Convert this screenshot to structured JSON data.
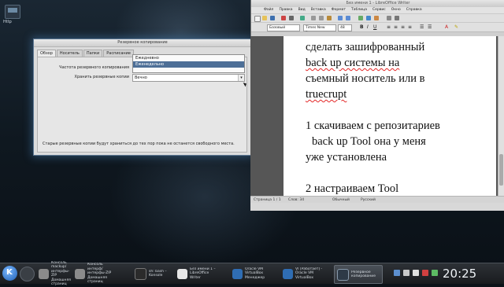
{
  "desktop": {
    "icon_label": "Http"
  },
  "backup_dialog": {
    "title": "Резервное копирование",
    "tabs": [
      "Обзор",
      "Носитель",
      "Папки",
      "Расписание"
    ],
    "frequency_label": "Частота резервного копирования",
    "frequency_options": [
      "Ежедневно",
      "Еженедельно"
    ],
    "keep_label": "Хранить резервные копии",
    "keep_value": "Вечно",
    "footer_note": "Старые резервные копии будут храниться до тех пор пока не останется свободного места."
  },
  "writer": {
    "title": "Без имени 1 - LibreOffice Writer",
    "menu": [
      "Файл",
      "Правка",
      "Вид",
      "Вставка",
      "Формат",
      "Таблица",
      "Сервис",
      "Окно",
      "Справка"
    ],
    "style": "Базовый",
    "font": "Times New Roman",
    "font_size": "48",
    "doc_lines": [
      "сделать зашифрованный",
      "back up системы на",
      "съемный носитель или в",
      "truecrupt",
      "1 скачиваем с репозитариев",
      "back up Tool она у меня",
      "уже установлена",
      "2 настраиваем Tool"
    ],
    "status": {
      "page": "Страница 1 / 1",
      "words": "Слов: 34",
      "style": "Обычный",
      "language": "Русский"
    }
  },
  "taskbar": {
    "tasks": [
      {
        "label": "Консоль mackup/интерфы-ZIP Домашняя страниц",
        "color": "#8b8b8b"
      },
      {
        "label": "Консоль интерф/интерфы-ZIP Домашняя страниц",
        "color": "#8b8b8b"
      },
      {
        "label": "sh: bash – Konsole",
        "color": "#2b2b2b"
      },
      {
        "label": "Без имени 1 – LibreOffice Writer",
        "color": "#e6e6e6"
      },
      {
        "label": "Oracle VM VirtualBox Менеджер",
        "color": "#2f6db3"
      },
      {
        "label": "VI [Работает] - Oracle VM VirtualBox",
        "color": "#2f6db3"
      },
      {
        "label": "Резервное копирование",
        "color": "#2e3a47"
      }
    ],
    "clock": "20:25"
  }
}
